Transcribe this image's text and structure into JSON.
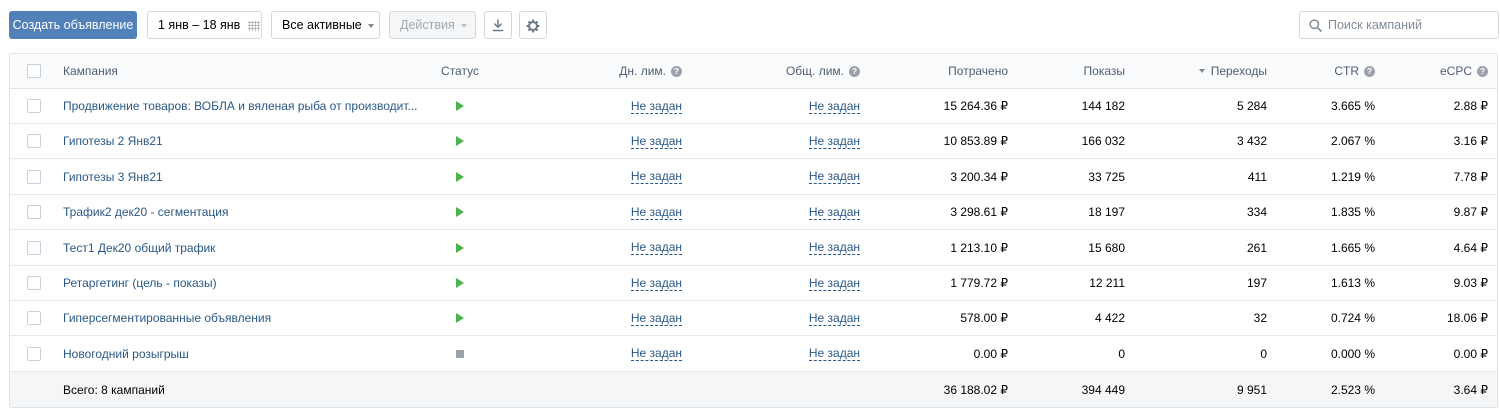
{
  "toolbar": {
    "create_label": "Создать объявление",
    "date_range": "1 янв – 18 янв",
    "filter_label": "Все активные",
    "actions_label": "Действия",
    "search_placeholder": "Поиск кампаний"
  },
  "columns": {
    "campaign": "Кампания",
    "status": "Статус",
    "day_limit": "Дн. лим.",
    "total_limit": "Общ. лим.",
    "spent": "Потрачено",
    "shows": "Показы",
    "clicks": "Переходы",
    "ctr": "CTR",
    "ecpc": "eCPC"
  },
  "rows": [
    {
      "name": "Продвижение товаров: ВОБЛА и вяленая рыба от производит...",
      "status": "active",
      "day_limit": "Не задан",
      "total_limit": "Не задан",
      "spent": "15 264.36 ₽",
      "shows": "144 182",
      "clicks": "5 284",
      "ctr": "3.665 %",
      "ecpc": "2.88 ₽"
    },
    {
      "name": "Гипотезы 2 Янв21",
      "status": "active",
      "day_limit": "Не задан",
      "total_limit": "Не задан",
      "spent": "10 853.89 ₽",
      "shows": "166 032",
      "clicks": "3 432",
      "ctr": "2.067 %",
      "ecpc": "3.16 ₽"
    },
    {
      "name": "Гипотезы 3 Янв21",
      "status": "active",
      "day_limit": "Не задан",
      "total_limit": "Не задан",
      "spent": "3 200.34 ₽",
      "shows": "33 725",
      "clicks": "411",
      "ctr": "1.219 %",
      "ecpc": "7.78 ₽"
    },
    {
      "name": "Трафик2 дек20 - сегментация",
      "status": "active",
      "day_limit": "Не задан",
      "total_limit": "Не задан",
      "spent": "3 298.61 ₽",
      "shows": "18 197",
      "clicks": "334",
      "ctr": "1.835 %",
      "ecpc": "9.87 ₽"
    },
    {
      "name": "Тест1 Дек20 общий трафик",
      "status": "active",
      "day_limit": "Не задан",
      "total_limit": "Не задан",
      "spent": "1 213.10 ₽",
      "shows": "15 680",
      "clicks": "261",
      "ctr": "1.665 %",
      "ecpc": "4.64 ₽"
    },
    {
      "name": "Ретаргетинг (цель - показы)",
      "status": "active",
      "day_limit": "Не задан",
      "total_limit": "Не задан",
      "spent": "1 779.72 ₽",
      "shows": "12 211",
      "clicks": "197",
      "ctr": "1.613 %",
      "ecpc": "9.03 ₽"
    },
    {
      "name": "Гиперсегментированные объявления",
      "status": "active",
      "day_limit": "Не задан",
      "total_limit": "Не задан",
      "spent": "578.00 ₽",
      "shows": "4 422",
      "clicks": "32",
      "ctr": "0.724 %",
      "ecpc": "18.06 ₽"
    },
    {
      "name": "Новогодний розыгрыш",
      "status": "stopped",
      "day_limit": "Не задан",
      "total_limit": "Не задан",
      "spent": "0.00 ₽",
      "shows": "0",
      "clicks": "0",
      "ctr": "0.000 %",
      "ecpc": "0.00 ₽"
    }
  ],
  "totals": {
    "label": "Всего: 8 кампаний",
    "spent": "36 188.02 ₽",
    "shows": "394 449",
    "clicks": "9 951",
    "ctr": "2.523 %",
    "ecpc": "3.64 ₽"
  },
  "colors": {
    "primary": "#5181b8",
    "link": "#2a5885",
    "active": "#4bb34b",
    "stopped": "#99a2ad"
  }
}
